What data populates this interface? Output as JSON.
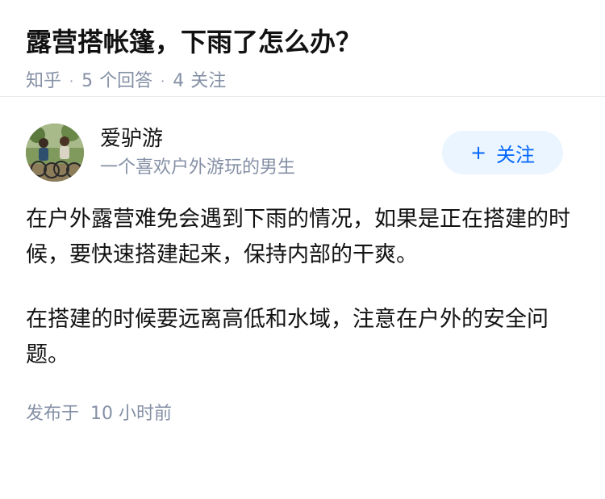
{
  "question": {
    "title": "露营搭帐篷，下雨了怎么办？",
    "source": "知乎",
    "separator": "·",
    "answer_count": "5",
    "answer_label": "个回答",
    "follower_count": "4",
    "follower_label": "关注"
  },
  "answer": {
    "author": {
      "name": "爱驴游",
      "bio": "一个喜欢户外游玩的男生"
    },
    "follow_button": {
      "icon": "+",
      "label": "关注"
    },
    "paragraphs": [
      "在户外露营难免会遇到下雨的情况，如果是正在搭建的时候，要快速搭建起来，保持内部的干爽。",
      "在搭建的时候要远离高低和水域，注意在户外的安全问题。"
    ],
    "published_prefix": "发布于",
    "published_time": "10 小时前"
  },
  "colors": {
    "accent": "#0066ff",
    "accent_bg": "#ebf5ff",
    "meta_text": "#8590a6",
    "body_text": "#121212"
  }
}
